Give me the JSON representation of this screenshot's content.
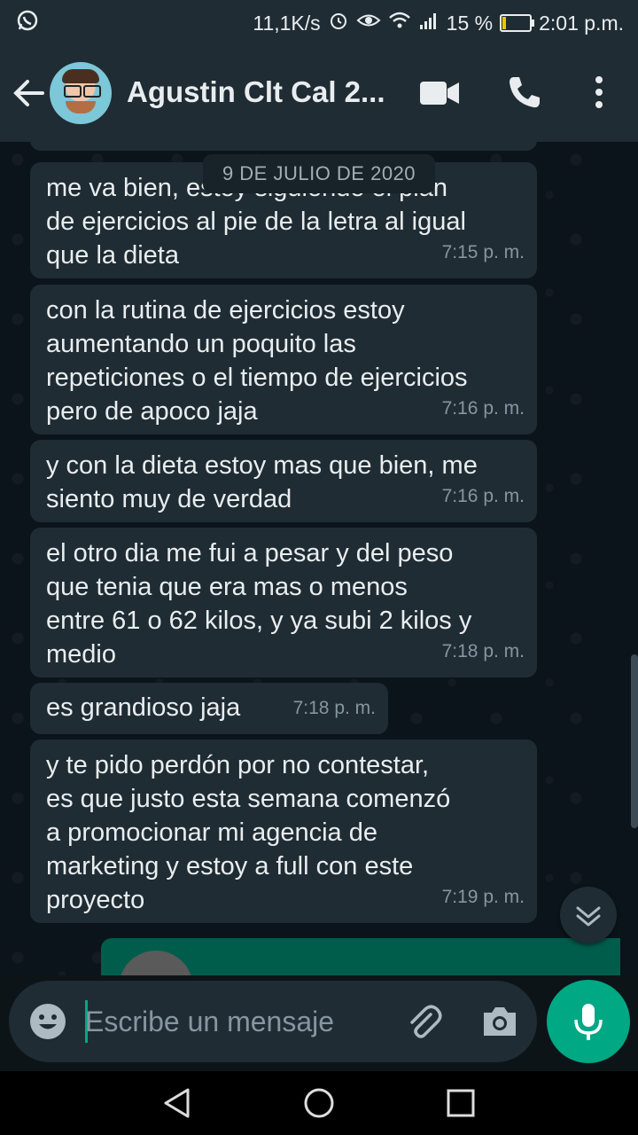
{
  "status_bar": {
    "network_speed": "11,1K/s",
    "battery_percent": "15 %",
    "time": "2:01 p.m.",
    "battery_level": 0.15
  },
  "header": {
    "contact_name": "Agustin Clt Cal 2...",
    "back_icon": "arrow-left-icon",
    "video_icon": "video-call-icon",
    "call_icon": "phone-icon",
    "menu_icon": "more-vert-icon"
  },
  "chat": {
    "date_chip": "9 DE JULIO DE 2020",
    "messages": [
      {
        "text": "me va bien, estoy siguiendo el plan\nde ejercicios al pie de la letra al igual\nque la dieta",
        "time": "7:15 p. m."
      },
      {
        "text": "con la rutina de ejercicios estoy\naumentando un poquito las\nrepeticiones o el tiempo de ejercicios\npero de apoco jaja",
        "time": "7:16 p. m."
      },
      {
        "text": "y con la dieta estoy mas que bien, me\nsiento muy de verdad",
        "time": "7:16 p. m."
      },
      {
        "text": "el otro dia me fui a pesar y del peso\nque tenia que era mas o menos\nentre 61 o 62 kilos, y ya subi 2 kilos y\nmedio",
        "time": "7:18 p. m."
      },
      {
        "text": "es grandioso jaja",
        "time": "7:18 p. m."
      },
      {
        "text": "y te pido perdón por no contestar,\nes que justo esta semana comenzó\na promocionar mi agencia de\nmarketing y estoy a full con este\nproyecto",
        "time": "7:19 p. m."
      }
    ]
  },
  "input": {
    "placeholder": "Escribe un mensaje",
    "emoji_icon": "emoji-icon",
    "attach_icon": "paperclip-icon",
    "camera_icon": "camera-icon",
    "mic_icon": "microphone-icon"
  },
  "colors": {
    "accent": "#00a884",
    "bubble": "#1f2c34",
    "background": "#0b141a"
  }
}
